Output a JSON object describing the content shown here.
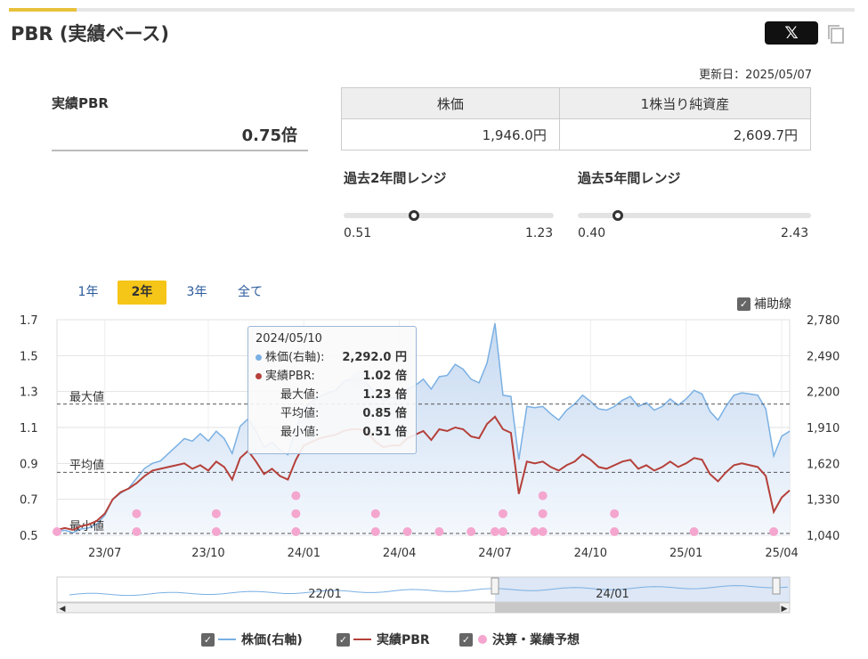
{
  "header": {
    "title": "PBR (実績ベース)",
    "x_label": "𝕏",
    "updated": "更新日：2025/05/07"
  },
  "summary": {
    "pbr_label": "実績PBR",
    "pbr_value": "0.75倍"
  },
  "stats_table": {
    "headers": [
      "株価",
      "1株当り純資産"
    ],
    "values": [
      "1,946.0円",
      "2,609.7円"
    ]
  },
  "ranges": [
    {
      "label": "過去2年間レンジ",
      "min": "0.51",
      "max": "1.23",
      "current": 0.75
    },
    {
      "label": "過去5年間レンジ",
      "min": "0.40",
      "max": "2.43",
      "current": 0.75
    }
  ],
  "period_tabs": [
    "1年",
    "2年",
    "3年",
    "全て"
  ],
  "active_tab": "2年",
  "aux_lines_label": "補助線",
  "legend": {
    "price": "株価(右軸)",
    "pbr": "実績PBR",
    "earnings": "決算・業績予想"
  },
  "tooltip": {
    "date": "2024/05/10",
    "rows": [
      {
        "label": "株価(右軸):",
        "value": "2,292.0 円"
      },
      {
        "label": "実績PBR:",
        "value": "1.02 倍"
      },
      {
        "label": "最大値:",
        "value": "1.23 倍"
      },
      {
        "label": "平均値:",
        "value": "0.85 倍"
      },
      {
        "label": "最小値:",
        "value": "0.51 倍"
      }
    ]
  },
  "colors": {
    "price": "#7ab0e3",
    "pbr": "#b5403a",
    "earnings": "#f4a6cf",
    "accent": "#f5c518"
  },
  "chart_data": {
    "type": "line",
    "x_ticks": [
      "23/07",
      "23/10",
      "24/01",
      "24/04",
      "24/07",
      "24/10",
      "25/01",
      "25/04"
    ],
    "x_tick_index": [
      6,
      19,
      31,
      43,
      55,
      67,
      79,
      91
    ],
    "left_axis": {
      "ticks": [
        "0.5",
        "0.7",
        "0.9",
        "1.1",
        "1.3",
        "1.5",
        "1.7"
      ],
      "ylim": [
        0.5,
        1.7
      ]
    },
    "right_axis": {
      "ticks": [
        "1,040",
        "1,330",
        "1,620",
        "1,910",
        "2,200",
        "2,490",
        "2,780"
      ],
      "ylim": [
        1040,
        2780
      ]
    },
    "ref_lines": [
      {
        "label": "最大値",
        "value": 1.23
      },
      {
        "label": "平均値",
        "value": 0.85
      },
      {
        "label": "最小値",
        "value": 0.51
      }
    ],
    "series": [
      {
        "name": "株価(右軸)",
        "axis": "right",
        "values": [
          1070,
          1080,
          1060,
          1090,
          1100,
          1130,
          1200,
          1330,
          1380,
          1420,
          1500,
          1580,
          1620,
          1640,
          1700,
          1760,
          1820,
          1800,
          1860,
          1800,
          1880,
          1820,
          1700,
          1920,
          1980,
          1880,
          1750,
          1790,
          1730,
          1690,
          1900,
          2060,
          2120,
          2160,
          2190,
          2210,
          2280,
          2300,
          2290,
          2260,
          2180,
          2130,
          2150,
          2150,
          2220,
          2250,
          2300,
          2220,
          2320,
          2330,
          2420,
          2380,
          2300,
          2270,
          2430,
          2750,
          2170,
          2160,
          1650,
          2080,
          2070,
          2080,
          2020,
          1970,
          2050,
          2100,
          2170,
          2120,
          2060,
          2050,
          2080,
          2130,
          2160,
          2080,
          2110,
          2050,
          2080,
          2140,
          2090,
          2140,
          2210,
          2180,
          2040,
          1970,
          2080,
          2170,
          2190,
          2180,
          2170,
          2060,
          1680,
          1840,
          1880
        ]
      },
      {
        "name": "実績PBR",
        "axis": "left",
        "values": [
          0.53,
          0.54,
          0.53,
          0.55,
          0.56,
          0.58,
          0.62,
          0.7,
          0.74,
          0.76,
          0.79,
          0.83,
          0.86,
          0.87,
          0.88,
          0.89,
          0.9,
          0.87,
          0.89,
          0.86,
          0.91,
          0.88,
          0.81,
          0.93,
          0.97,
          0.91,
          0.84,
          0.87,
          0.83,
          0.81,
          0.92,
          1.0,
          1.02,
          1.04,
          1.05,
          1.06,
          1.08,
          1.09,
          1.09,
          1.07,
          1.02,
          0.99,
          1.0,
          1.0,
          1.04,
          1.06,
          1.08,
          1.03,
          1.09,
          1.08,
          1.1,
          1.09,
          1.05,
          1.04,
          1.12,
          1.16,
          1.09,
          1.07,
          0.73,
          0.91,
          0.9,
          0.91,
          0.88,
          0.86,
          0.89,
          0.91,
          0.95,
          0.92,
          0.88,
          0.87,
          0.89,
          0.91,
          0.92,
          0.87,
          0.89,
          0.86,
          0.88,
          0.91,
          0.88,
          0.9,
          0.93,
          0.92,
          0.84,
          0.8,
          0.85,
          0.89,
          0.9,
          0.89,
          0.88,
          0.83,
          0.63,
          0.71,
          0.75
        ]
      },
      {
        "name": "決算・業績予想",
        "type": "scatter",
        "points": [
          [
            0,
            0.51
          ],
          [
            10,
            0.51
          ],
          [
            10,
            0.61
          ],
          [
            20,
            0.51
          ],
          [
            20,
            0.61
          ],
          [
            30,
            0.51
          ],
          [
            30,
            0.61
          ],
          [
            30,
            0.71
          ],
          [
            40,
            0.51
          ],
          [
            40,
            0.61
          ],
          [
            44,
            0.51
          ],
          [
            48,
            0.51
          ],
          [
            52,
            0.51
          ],
          [
            55,
            0.51
          ],
          [
            56,
            0.51
          ],
          [
            56,
            0.61
          ],
          [
            60,
            0.51
          ],
          [
            61,
            0.51
          ],
          [
            61,
            0.61
          ],
          [
            61,
            0.71
          ],
          [
            70,
            0.51
          ],
          [
            70,
            0.61
          ],
          [
            80,
            0.51
          ],
          [
            90,
            0.51
          ]
        ]
      }
    ],
    "navigator": {
      "labels": [
        "22/01",
        "24/01"
      ]
    },
    "grid": true
  }
}
